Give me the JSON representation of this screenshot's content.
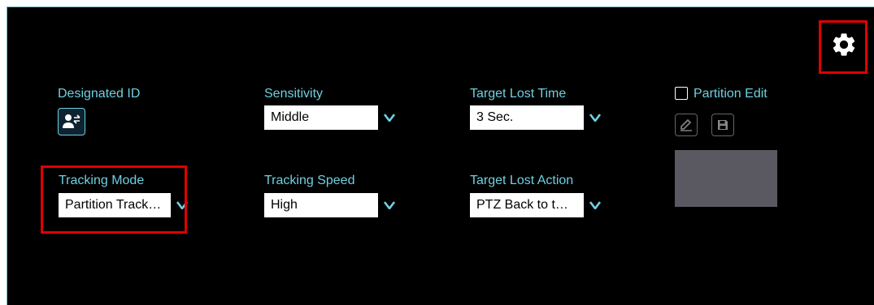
{
  "settings": {
    "icon": "gear-icon",
    "color": "#ffffff"
  },
  "designated_id": {
    "label": "Designated ID",
    "icon": "person-swap-icon"
  },
  "sensitivity": {
    "label": "Sensitivity",
    "value": "Middle"
  },
  "target_lost_time": {
    "label": "Target Lost Time",
    "value": "3 Sec."
  },
  "partition_edit": {
    "label": "Partition Edit",
    "checked": false,
    "edit_icon": "pencil-icon",
    "save_icon": "save-icon"
  },
  "tracking_mode": {
    "label": "Tracking Mode",
    "value": "Partition Track…"
  },
  "tracking_speed": {
    "label": "Tracking Speed",
    "value": "High"
  },
  "target_lost_action": {
    "label": "Target Lost Action",
    "value": "PTZ Back to t…"
  },
  "colors": {
    "label": "#6fd0e0",
    "arrow": "#6fd0e0",
    "preview": "#5a5962",
    "highlight": "#e00000",
    "panel": "#000000"
  }
}
